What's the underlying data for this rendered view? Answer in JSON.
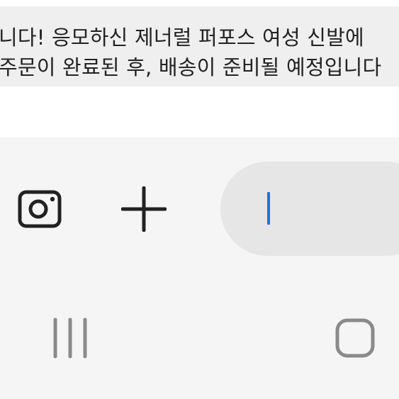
{
  "chat": {
    "message_line_1": "니다! 응모하신 제너럴 퍼포스 여성 신발에",
    "message_line_2": "주문이 완료된 후, 배송이 준비될 예정입니다"
  },
  "composer": {
    "camera_icon": "camera-icon",
    "add_icon": "plus-icon",
    "input_value": ""
  },
  "navigation": {
    "recents_icon": "recent-apps-icon",
    "home_icon": "home-icon"
  },
  "colors": {
    "cursor": "#1e73d8",
    "icon": "#222222",
    "nav_icon": "#8a8a8a"
  }
}
